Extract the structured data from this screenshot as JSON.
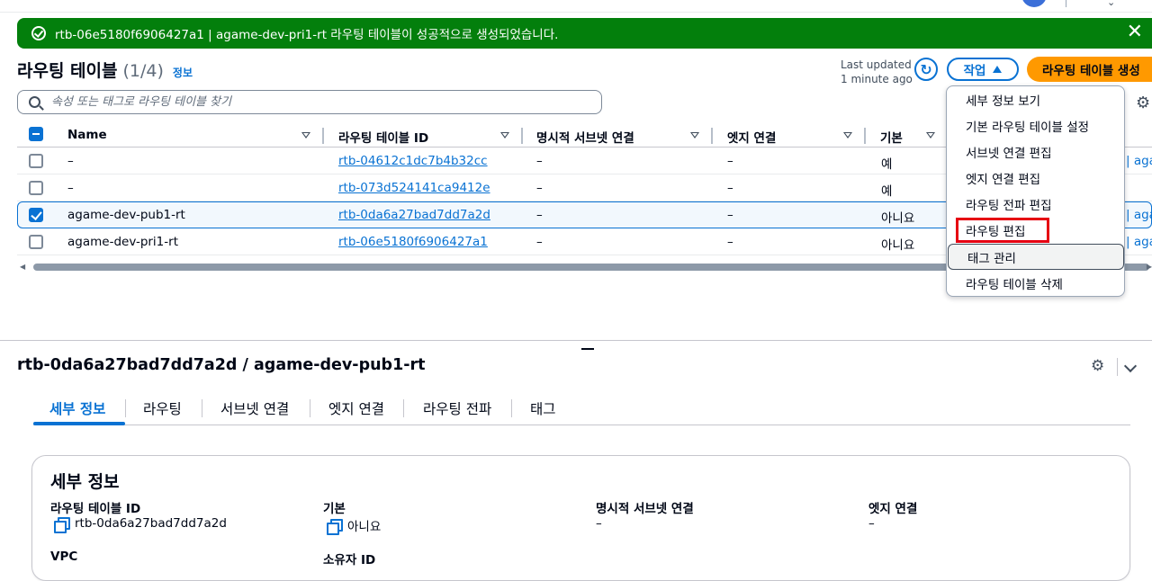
{
  "flash": {
    "message": "rtb-06e5180f6906427a1 | agame-dev-pri1-rt 라우팅 테이블이 성공적으로 생성되었습니다.",
    "close_glyph": "✕"
  },
  "header": {
    "title": "라우팅 테이블",
    "count": "(1/4)",
    "info": "정보",
    "last_updated_line1": "Last updated",
    "last_updated_line2": "1 minute ago",
    "actions_label": "작업",
    "create_label": "라우팅 테이블 생성"
  },
  "search": {
    "placeholder": "속성 또는 태그로 라우팅 테이블 찾기"
  },
  "table": {
    "columns": [
      "Name",
      "라우팅 테이블 ID",
      "명시적 서브넷 연결",
      "엣지 연결",
      "기본"
    ],
    "rows": [
      {
        "name": "–",
        "id": "rtb-04612c1dc7b4b32cc",
        "subnet": "–",
        "edge": "–",
        "main": "예",
        "tail": "| aga",
        "checked": false
      },
      {
        "name": "–",
        "id": "rtb-073d524141ca9412e",
        "subnet": "–",
        "edge": "–",
        "main": "예",
        "tail": "",
        "checked": false
      },
      {
        "name": "agame-dev-pub1-rt",
        "id": "rtb-0da6a27bad7dd7a2d",
        "subnet": "–",
        "edge": "–",
        "main": "아니요",
        "tail": "| aga",
        "checked": true
      },
      {
        "name": "agame-dev-pri1-rt",
        "id": "rtb-06e5180f6906427a1",
        "subnet": "–",
        "edge": "–",
        "main": "아니요",
        "tail": "| aga",
        "checked": false
      }
    ]
  },
  "actions_menu": {
    "items": [
      "세부 정보 보기",
      "기본 라우팅 테이블 설정",
      "서브넷 연결 편집",
      "엣지 연결 편집",
      "라우팅 전파 편집",
      "라우팅 편집",
      "태그 관리",
      "라우팅 테이블 삭제"
    ],
    "highlighted_item": "라우팅 편집",
    "hovered_item": "태그 관리"
  },
  "detail": {
    "title": "rtb-0da6a27bad7dd7a2d / agame-dev-pub1-rt",
    "tabs": [
      "세부 정보",
      "라우팅",
      "서브넷 연결",
      "엣지 연결",
      "라우팅 전파",
      "태그"
    ],
    "active_tab": "세부 정보",
    "panel_title": "세부 정보",
    "fields": {
      "rt_id_label": "라우팅 테이블 ID",
      "rt_id_value": "rtb-0da6a27bad7dd7a2d",
      "main_label": "기본",
      "main_value": "아니요",
      "subnet_label": "명시적 서브넷 연결",
      "subnet_value": "–",
      "edge_label": "엣지 연결",
      "edge_value": "–",
      "vpc_label": "VPC",
      "owner_label": "소유자 ID"
    }
  },
  "colors": {
    "accent": "#0972d3",
    "success": "#037f0c",
    "primary_button": "#ff9900",
    "callout": "#e60012"
  }
}
